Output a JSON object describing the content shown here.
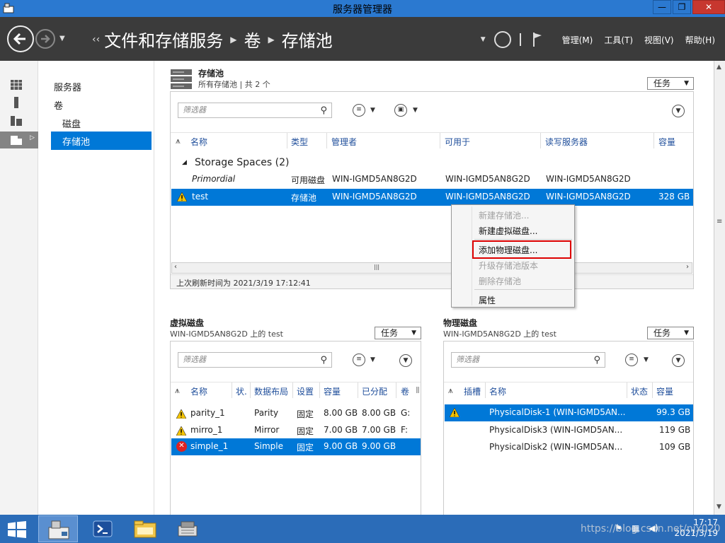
{
  "window": {
    "title": "服务器管理器",
    "minimize": "—",
    "maximize": "❐",
    "close": "✕"
  },
  "header": {
    "breadcrumb": [
      "文件和存储服务",
      "卷",
      "存储池"
    ],
    "menus": [
      "管理(M)",
      "工具(T)",
      "视图(V)",
      "帮助(H)"
    ]
  },
  "nav": {
    "items": [
      "服务器",
      "卷",
      "磁盘",
      "存储池"
    ],
    "selected": "存储池"
  },
  "pools": {
    "title": "存储池",
    "subtitle": "所有存储池 | 共 2 个",
    "tasks": "任务",
    "filter_placeholder": "筛选器",
    "columns": [
      "名称",
      "类型",
      "管理者",
      "可用于",
      "读写服务器",
      "容量"
    ],
    "group": "Storage Spaces (2)",
    "rows": [
      {
        "name": "Primordial",
        "type": "可用磁盘",
        "managed": "WIN-IGMD5AN8G2D",
        "available": "WIN-IGMD5AN8G2D",
        "rw": "WIN-IGMD5AN8G2D",
        "capacity": ""
      },
      {
        "name": "test",
        "type": "存储池",
        "managed": "WIN-IGMD5AN8G2D",
        "available": "WIN-IGMD5AN8G2D",
        "rw": "WIN-IGMD5AN8G2D",
        "capacity": "328 GB"
      }
    ],
    "last_refresh": "上次刷新时间为 2021/3/19 17:12:41"
  },
  "context_menu": {
    "items": [
      {
        "label": "新建存储池...",
        "disabled": true
      },
      {
        "label": "新建虚拟磁盘...",
        "disabled": false
      },
      {
        "label": "添加物理磁盘...",
        "disabled": false
      },
      {
        "label": "升级存储池版本",
        "disabled": true
      },
      {
        "label": "删除存储池",
        "disabled": true
      },
      {
        "label": "属性",
        "disabled": false
      }
    ]
  },
  "vdisks": {
    "title": "虚拟磁盘",
    "subtitle": "WIN-IGMD5AN8G2D 上的 test",
    "tasks": "任务",
    "filter_placeholder": "筛选器",
    "columns": [
      "名称",
      "状.",
      "数据布局",
      "设置",
      "容量",
      "已分配",
      "卷",
      "Ⅱ"
    ],
    "rows": [
      {
        "name": "parity_1",
        "layout": "Parity",
        "prov": "固定",
        "cap": "8.00 GB",
        "alloc": "8.00 GB",
        "vol": "G:"
      },
      {
        "name": "mirro_1",
        "layout": "Mirror",
        "prov": "固定",
        "cap": "7.00 GB",
        "alloc": "7.00 GB",
        "vol": "F:"
      },
      {
        "name": "simple_1",
        "layout": "Simple",
        "prov": "固定",
        "cap": "9.00 GB",
        "alloc": "9.00 GB",
        "vol": ""
      }
    ]
  },
  "pdisks": {
    "title": "物理磁盘",
    "subtitle": "WIN-IGMD5AN8G2D 上的 test",
    "tasks": "任务",
    "filter_placeholder": "筛选器",
    "columns": [
      "插槽",
      "名称",
      "状态",
      "容量"
    ],
    "rows": [
      {
        "name": "PhysicalDisk-1 (WIN-IGMD5AN...",
        "cap": "99.3 GB"
      },
      {
        "name": "PhysicalDisk3 (WIN-IGMD5AN...",
        "cap": "119 GB"
      },
      {
        "name": "PhysicalDisk2 (WIN-IGMD5AN...",
        "cap": "109 GB"
      }
    ]
  },
  "taskbar": {
    "time": "17:17",
    "date": "2021/3/19"
  },
  "watermark": "https://blog.csdn.net/njx020",
  "colors": {
    "accent": "#0078d7",
    "header_bg": "#3b3b3b",
    "titlebar": "#2b79d0",
    "taskbar": "#2b6cb8",
    "warn": "#f5c400",
    "error": "#dd2222"
  }
}
